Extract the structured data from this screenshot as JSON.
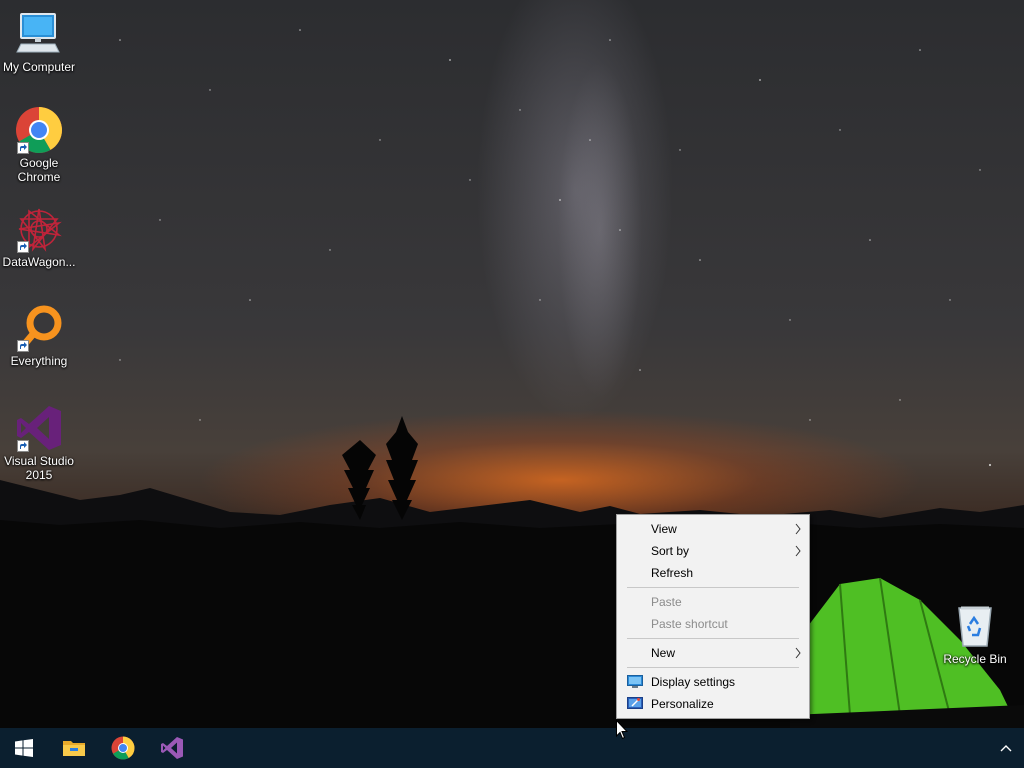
{
  "desktop": {
    "icons": [
      {
        "label": "My Computer",
        "icon": "monitor-icon"
      },
      {
        "label": "Google\nChrome",
        "icon": "chrome-icon"
      },
      {
        "label": "DataWagon...",
        "icon": "datawagon-icon"
      },
      {
        "label": "Everything",
        "icon": "everything-icon"
      },
      {
        "label": "Visual Studio\n2015",
        "icon": "visual-studio-icon"
      },
      {
        "label": "Recycle Bin",
        "icon": "recycle-bin-icon"
      }
    ]
  },
  "context_menu": {
    "view": "View",
    "sort_by": "Sort by",
    "refresh": "Refresh",
    "paste": "Paste",
    "paste_shortcut": "Paste shortcut",
    "new": "New",
    "display_settings": "Display settings",
    "personalize": "Personalize"
  },
  "taskbar": {
    "items": [
      "start-icon",
      "file-explorer-icon",
      "chrome-icon",
      "visual-studio-icon"
    ],
    "tray": "chevron-up-icon"
  },
  "colors": {
    "taskbar": "#0b1f2f",
    "menu_bg": "#f2f2f2",
    "vs_purple": "#68217a",
    "everything_orange": "#f7931e"
  }
}
